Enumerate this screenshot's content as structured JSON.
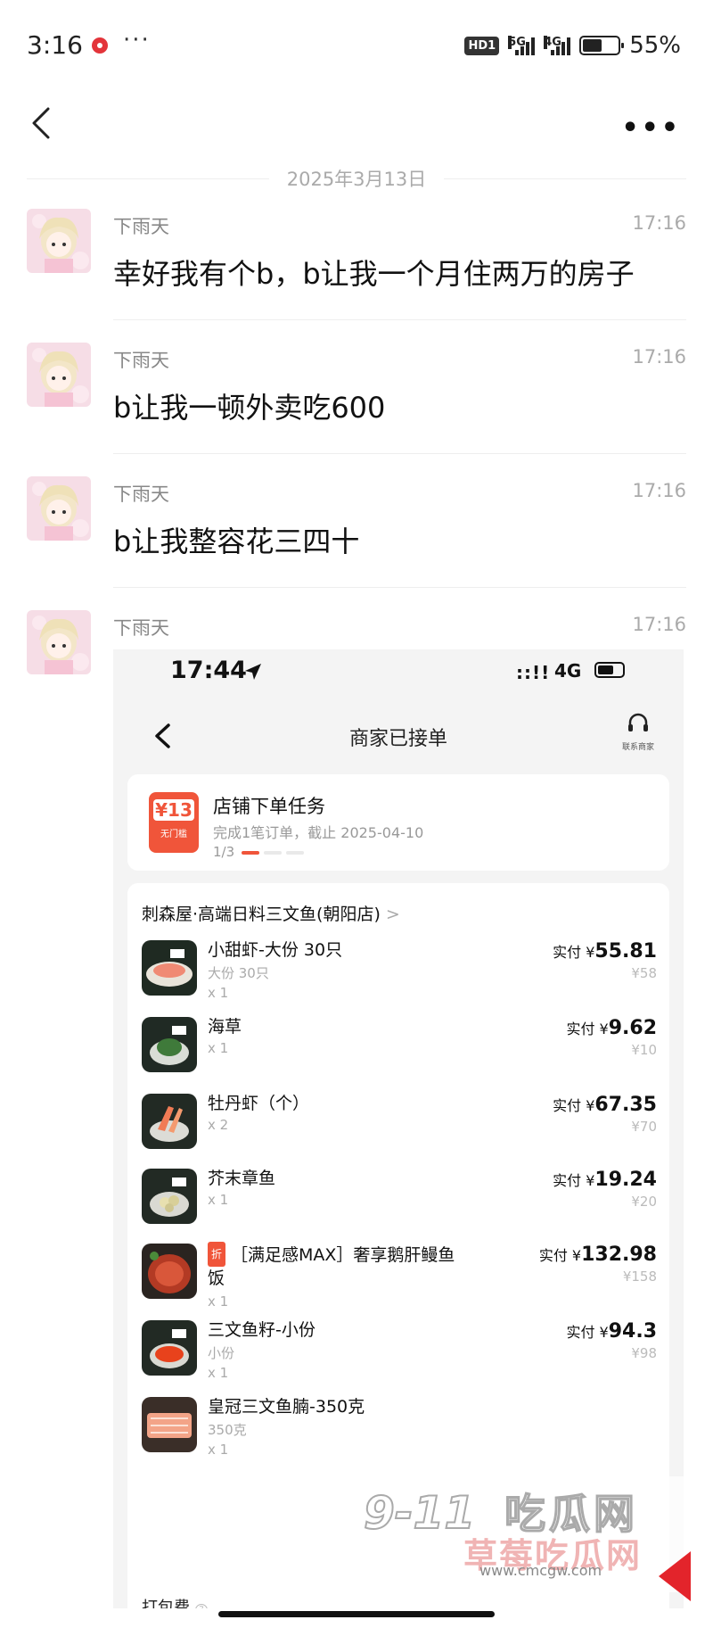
{
  "status_bar": {
    "time": "3:16",
    "more": "···",
    "hd_badge": "HD1",
    "net1": "5G",
    "net2": "4G",
    "battery_percent": "55%",
    "battery_level": 0.55
  },
  "chat": {
    "date_divider": "2025年3月13日",
    "messages": [
      {
        "sender": "下雨天",
        "time": "17:16",
        "text": "幸好我有个b，b让我一个月住两万的房子"
      },
      {
        "sender": "下雨天",
        "time": "17:16",
        "text": "b让我一顿外卖吃600"
      },
      {
        "sender": "下雨天",
        "time": "17:16",
        "text": "b让我整容花三四十"
      },
      {
        "sender": "下雨天",
        "time": "17:16",
        "text": ""
      }
    ]
  },
  "screenshot": {
    "status_time": "17:44",
    "status_signal": "::!!",
    "status_network": "4G",
    "title": "商家已接单",
    "cs_label": "联系商家",
    "task": {
      "coupon_value": "¥13",
      "coupon_sub": "无门槛",
      "title": "店铺下单任务",
      "desc": "完成1笔订单，截止 2025-04-10",
      "progress": "1/3"
    },
    "shop_name": "刺森屋·高端日料三文鱼(朝阳店)",
    "shop_chevron": ">",
    "items": [
      {
        "name": "小甜虾-大份 30只",
        "sub": "大份 30只",
        "qty": "x 1",
        "paid_label": "实付 ¥",
        "paid": "55.81",
        "orig": "¥58",
        "discount": ""
      },
      {
        "name": "海草",
        "sub": "",
        "qty": "x 1",
        "paid_label": "实付 ¥",
        "paid": "9.62",
        "orig": "¥10",
        "discount": ""
      },
      {
        "name": "牡丹虾（个）",
        "sub": "",
        "qty": "x 2",
        "paid_label": "实付 ¥",
        "paid": "67.35",
        "orig": "¥70",
        "discount": ""
      },
      {
        "name": "芥末章鱼",
        "sub": "",
        "qty": "x 1",
        "paid_label": "实付 ¥",
        "paid": "19.24",
        "orig": "¥20",
        "discount": ""
      },
      {
        "name": "［满足感MAX］奢享鹅肝鳗鱼饭",
        "sub": "",
        "qty": "x 1",
        "paid_label": "实付 ¥",
        "paid": "132.98",
        "orig": "¥158",
        "discount": "折"
      },
      {
        "name": "三文鱼籽-小份",
        "sub": "小份",
        "qty": "x 1",
        "paid_label": "实付 ¥",
        "paid": "94.3",
        "orig": "¥98",
        "discount": ""
      },
      {
        "name": "皇冠三文鱼腩-350克",
        "sub": "350克",
        "qty": "x 1",
        "paid_label": "实付 ¥",
        "paid": "",
        "orig": "",
        "discount": ""
      }
    ],
    "pack_fee_label": "打包费",
    "pack_fee_info": "?"
  },
  "watermark": {
    "num": "9-11",
    "big": "吃瓜网",
    "sub": "草莓吃瓜网",
    "url": "www.cmcgw.com"
  },
  "colors": {
    "accent": "#f0553a",
    "muted": "#999999",
    "background": "#ffffff"
  },
  "icons": {
    "back": "chevron-left-icon",
    "more": "more-dots-icon",
    "location": "location-arrow-icon",
    "support": "headset-icon"
  }
}
